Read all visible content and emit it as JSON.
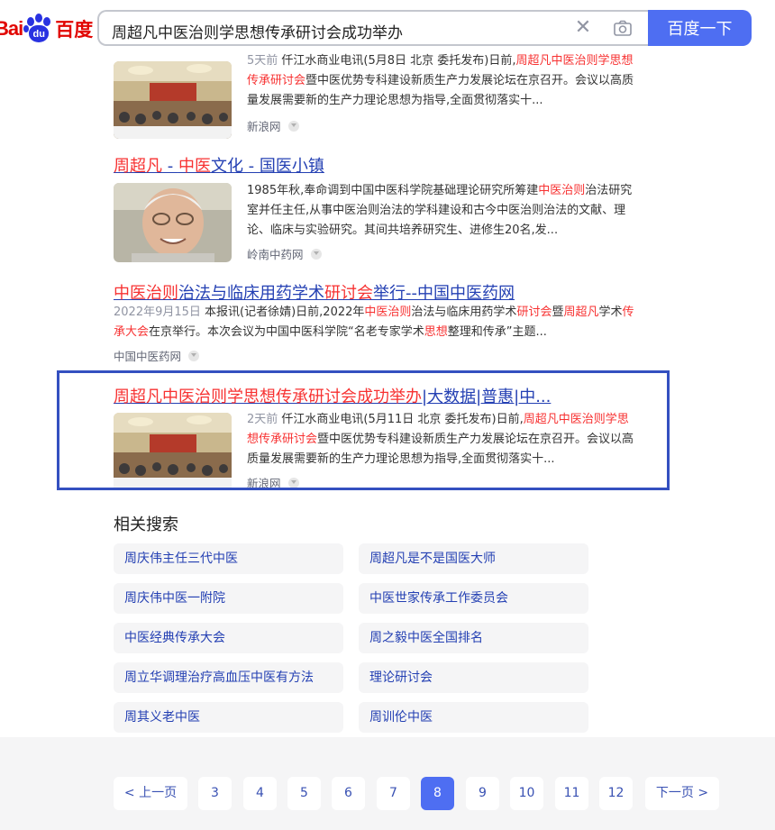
{
  "header": {
    "logo_text_left": "Bai",
    "logo_text_paw": "du",
    "logo_text_cn": "百度",
    "search_query": "周超凡中医治则学思想传承研讨会成功举办",
    "clear_icon": "close-icon",
    "camera_icon": "camera-icon",
    "search_button": "百度一下"
  },
  "results": [
    {
      "snippet_parts": [
        {
          "t": "5天前 ",
          "c": "date"
        },
        {
          "t": "仟江水商业电讯(5月8日 北京 委托发布)日前,"
        },
        {
          "t": "周超凡中医治则学思想传承研讨会",
          "c": "em"
        },
        {
          "t": "暨中医优势专科建设新质生产力发展论坛在京召开。会议以高质量发展需要新的生产力理论思想为指导,全面贯彻落实十..."
        }
      ],
      "source": "新浪网"
    },
    {
      "title_parts": [
        {
          "t": "周超凡",
          "c": "em"
        },
        {
          "t": " - "
        },
        {
          "t": "中医",
          "c": "em"
        },
        {
          "t": "文化 - 国医小镇"
        }
      ],
      "snippet_parts": [
        {
          "t": "1985年秋,奉命调到中国中医科学院基础理论研究所筹建"
        },
        {
          "t": "中医治则",
          "c": "em"
        },
        {
          "t": "治法研究室并任主任,从事中医治则治法的学科建设和古今中医治则治法的文献、理论、临床与实验研究。其间共培养研究生、进修生20名,发..."
        }
      ],
      "source": "岭南中药网"
    },
    {
      "title_parts": [
        {
          "t": "中医治则",
          "c": "em"
        },
        {
          "t": "治法与临床用药学术"
        },
        {
          "t": "研讨会",
          "c": "em"
        },
        {
          "t": "举行--中国中医药网"
        }
      ],
      "snippet_parts": [
        {
          "t": "2022年9月15日 ",
          "c": "date"
        },
        {
          "t": "本报讯(记者徐婧)日前,2022年"
        },
        {
          "t": "中医治则",
          "c": "em"
        },
        {
          "t": "治法与临床用药学术"
        },
        {
          "t": "研讨会",
          "c": "em"
        },
        {
          "t": "暨"
        },
        {
          "t": "周超凡",
          "c": "em"
        },
        {
          "t": "学术"
        },
        {
          "t": "传承大会",
          "c": "em"
        },
        {
          "t": "在京举行。本次会议为中国中医科学院“名老专家学术"
        },
        {
          "t": "思想",
          "c": "em"
        },
        {
          "t": "整理和传承”主题..."
        }
      ],
      "source": "中国中医药网"
    },
    {
      "title_parts": [
        {
          "t": "周超凡中医治则学思想传承研讨会成功举办",
          "c": "em"
        },
        {
          "t": "|大数据|普惠|中..."
        }
      ],
      "snippet_parts": [
        {
          "t": "2天前 ",
          "c": "date"
        },
        {
          "t": "仟江水商业电讯(5月11日 北京 委托发布)日前,"
        },
        {
          "t": "周超凡中医治则学思想传承研讨会",
          "c": "em"
        },
        {
          "t": "暨中医优势专科建设新质生产力发展论坛在京召开。会议以高质量发展需要新的生产力理论思想为指导,全面贯彻落实十..."
        }
      ],
      "source": "新浪网"
    }
  ],
  "related": {
    "title": "相关搜索",
    "items": [
      "周庆伟主任三代中医",
      "周超凡是不是国医大师",
      "周庆伟中医一附院",
      "中医世家传承工作委员会",
      "中医经典传承大会",
      "周之毅中医全国排名",
      "周立华调理治疗高血压中医有方法",
      "理论研讨会",
      "周其义老中医",
      "周训伦中医"
    ]
  },
  "pager": {
    "prev": "< 上一页",
    "pages": [
      "3",
      "4",
      "5",
      "6",
      "7",
      "8",
      "9",
      "10",
      "11",
      "12"
    ],
    "current": "8",
    "next": "下一页 >"
  },
  "colors": {
    "link": "#2440b3",
    "highlight": "#f73131",
    "brand_blue": "#4e6ef2",
    "logo_red": "#e10602",
    "annotation_box": "#3450c0"
  }
}
